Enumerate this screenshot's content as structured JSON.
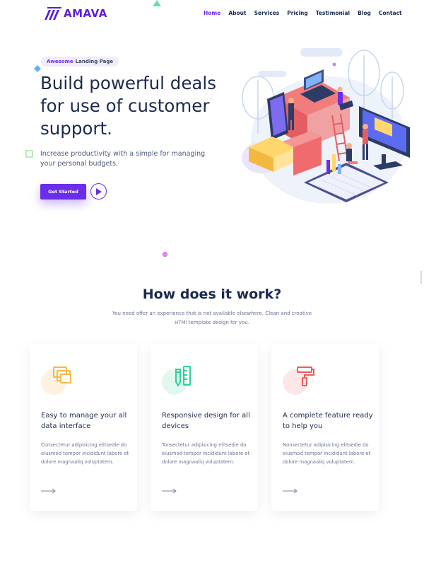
{
  "brand": {
    "name": "AMAVA",
    "color": "#5b1fd8"
  },
  "nav": {
    "items": [
      {
        "label": "Home",
        "active": true
      },
      {
        "label": "About"
      },
      {
        "label": "Services"
      },
      {
        "label": "Pricing"
      },
      {
        "label": "Testimonial"
      },
      {
        "label": "Blog"
      },
      {
        "label": "Contact"
      }
    ]
  },
  "hero": {
    "badge_highlight": "Awesome",
    "badge_rest": "Landing Page",
    "title": "Build powerful deals for use of customer support.",
    "description": "Increase productivity with a simple for managing your personal budgets.",
    "cta_label": "Get Started",
    "play_icon": "play-icon"
  },
  "how": {
    "title": "How does it work?",
    "subtitle": "You need offer an experience that is not available elsewhere. Clean and creative HTMl template design for you.",
    "cards": [
      {
        "title": "Easy to manage your all data interface",
        "text": "Consectetur adipisicing elitsedie do eiusmod tempor incididunt labore et dolore magnaaliq voluptatem.",
        "icon": "copy-icon",
        "accent": "#f6b84a",
        "accent_bg": "#fdf1e0"
      },
      {
        "title": "Responsive design for all devices",
        "text": "Tonsectetur adipisicing elitsedie do eiusmod tempor incididunt labore et dolore magnaaliq voluptatem.",
        "icon": "ruler-pencil-icon",
        "accent": "#2fcf96",
        "accent_bg": "#e2f8ef"
      },
      {
        "title": "A complete feature ready to help you",
        "text": "Nonsectetur adipisicing elitsedie do eiusmod tempor incididunt labore et dolore magnaaliq voluptatem.",
        "icon": "paint-roller-icon",
        "accent": "#f0595c",
        "accent_bg": "#fde7e7"
      }
    ]
  },
  "colors": {
    "primary": "#6a2de8",
    "heading": "#1b2a4e",
    "body": "#6a7390"
  }
}
